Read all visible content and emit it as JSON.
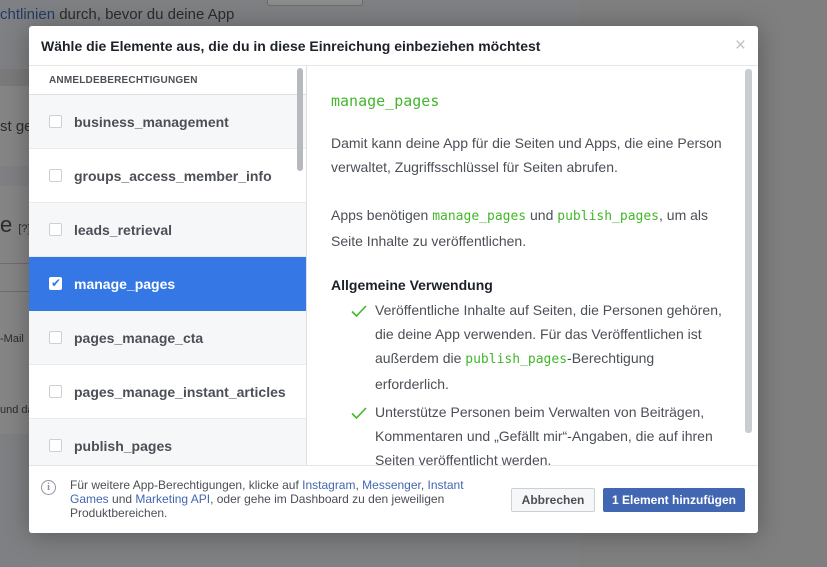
{
  "background": {
    "line1_link": "chtlinien",
    "line1_text": " durch, bevor du deine App",
    "text_a": "st ge",
    "text_b": "e",
    "text_b_badge": "[?]",
    "text_c": "-Mail",
    "text_d": "und da"
  },
  "dialog": {
    "title": "Wähle die Elemente aus, die du in diese Einreichung einbeziehen möchtest",
    "close_icon": "×"
  },
  "left_panel": {
    "section_header": "ANMELDEBERECHTIGUNGEN",
    "items": [
      {
        "label": "business_management",
        "checked": false
      },
      {
        "label": "groups_access_member_info",
        "checked": false
      },
      {
        "label": "leads_retrieval",
        "checked": false
      },
      {
        "label": "manage_pages",
        "checked": true
      },
      {
        "label": "pages_manage_cta",
        "checked": false
      },
      {
        "label": "pages_manage_instant_articles",
        "checked": false
      },
      {
        "label": "publish_pages",
        "checked": false
      }
    ],
    "check_glyph": "✔"
  },
  "detail": {
    "title": "manage_pages",
    "para1": "Damit kann deine App für die Seiten und Apps, die eine Person verwaltet, Zugriffsschlüssel für Seiten abrufen.",
    "para2_a": "Apps benötigen ",
    "para2_code1": "manage_pages",
    "para2_b": " und ",
    "para2_code2": "publish_pages",
    "para2_c": ", um als Seite Inhalte zu veröffentlichen.",
    "section_title": "Allgemeine Verwendung",
    "usage1_a": "Veröffentliche Inhalte auf Seiten, die Personen gehören, die deine App verwenden. Für das Veröffentlichen ist außerdem die ",
    "usage1_code": "publish_pages",
    "usage1_b": "-Berechtigung erforderlich.",
    "usage2": "Unterstütze Personen beim Verwalten von Beiträgen, Kommentaren und „Gefällt mir“-Angaben, die auf ihren Seiten veröffentlicht werden."
  },
  "footer": {
    "info_icon": "i",
    "text_1": "Für weitere App-Berechtigungen, klicke auf ",
    "link_instagram": "Instagram",
    "sep_1": ", ",
    "link_messenger": "Messenger",
    "sep_2": ", ",
    "link_instant_games": "Instant Games",
    "text_2": " und ",
    "link_marketing_api": "Marketing API",
    "text_3": ", oder gehe im Dashboard zu den jeweiligen Produktbereichen.",
    "cancel_label": "Abbrechen",
    "add_label": "1 Element hinzufügen"
  },
  "colors": {
    "accent": "#4267b2",
    "selected": "#3578e5",
    "code_green": "#42b72a"
  }
}
